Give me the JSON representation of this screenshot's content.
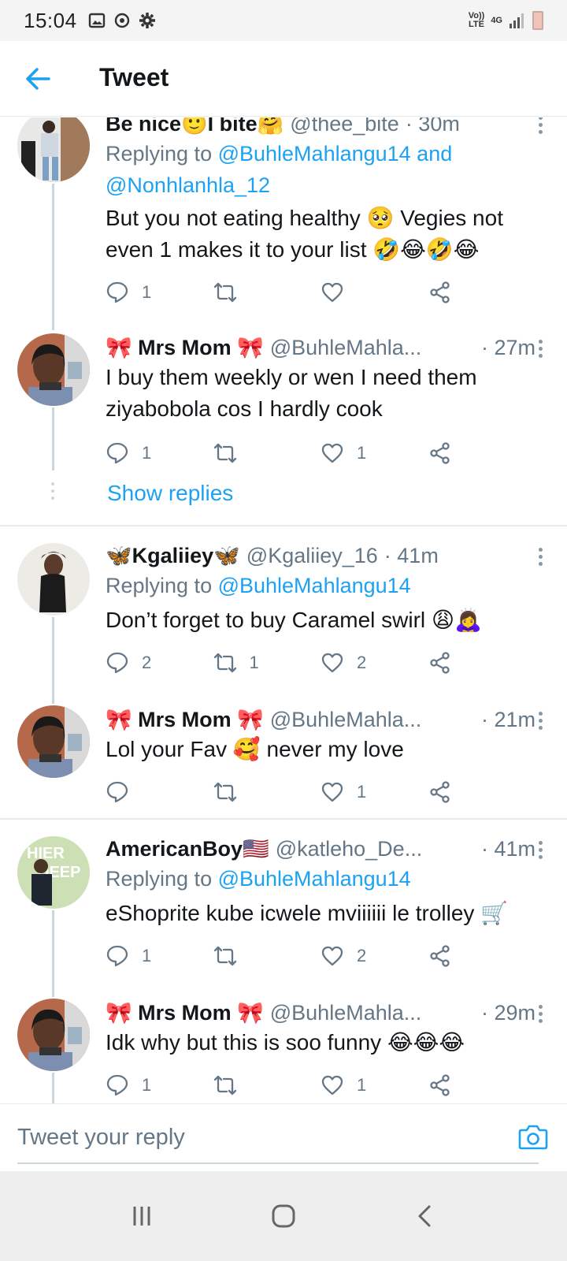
{
  "status_bar": {
    "time": "15:04",
    "volte": "Vo))\nLTE",
    "network": "4G"
  },
  "app_bar": {
    "title": "Tweet"
  },
  "tweets": [
    {
      "name": "Be nice🙂I bite🤗",
      "handle": "@thee_bite",
      "time": "· 30m",
      "reply_prefix": "Replying to ",
      "reply_to": "@BuhleMahlangu14 and @Nonhlanhla_12",
      "text": "But you not eating healthy 🥺 Vegies not even 1 makes it to your list 🤣😂🤣😂",
      "replies": "1",
      "retweets": "",
      "likes": ""
    },
    {
      "name": "🎀 Mrs Mom 🎀",
      "handle": "@BuhleMahla...",
      "time": "· 27m",
      "text": "I buy them weekly or wen I need them ziyabobola cos I hardly cook",
      "replies": "1",
      "retweets": "",
      "likes": "1"
    },
    {
      "name": "🦋Kgaliiey🦋",
      "handle": "@Kgaliiey_16",
      "time": "· 41m",
      "reply_prefix": "Replying to ",
      "reply_to": "@BuhleMahlangu14",
      "text": "Don’t forget to buy Caramel swirl 😩🙇‍♀️",
      "replies": "2",
      "retweets": "1",
      "likes": "2"
    },
    {
      "name": "🎀 Mrs Mom 🎀",
      "handle": "@BuhleMahla...",
      "time": "· 21m",
      "text": "Lol your Fav 🥰 never my love",
      "replies": "",
      "retweets": "",
      "likes": "1"
    },
    {
      "name": "AmericanBoy🇺🇸",
      "handle": "@katleho_De...",
      "time": "· 41m",
      "reply_prefix": "Replying to ",
      "reply_to": "@BuhleMahlangu14",
      "text": "eShoprite kube icwele mviiiiii le trolley 🛒",
      "replies": "1",
      "retweets": "",
      "likes": "2"
    },
    {
      "name": "🎀 Mrs Mom 🎀",
      "handle": "@BuhleMahla...",
      "time": "· 29m",
      "text": "Idk why but this is soo funny 😂😂😂",
      "replies": "1",
      "retweets": "",
      "likes": "1"
    }
  ],
  "show_replies": "Show replies",
  "avatar_texts": {
    "american_boy": "HIER TO DEEP"
  },
  "reply_bar": {
    "placeholder": "Tweet your reply"
  },
  "colors": {
    "accent": "#1da1f2",
    "secondary_text": "#657786",
    "line": "#ccd6dd"
  }
}
